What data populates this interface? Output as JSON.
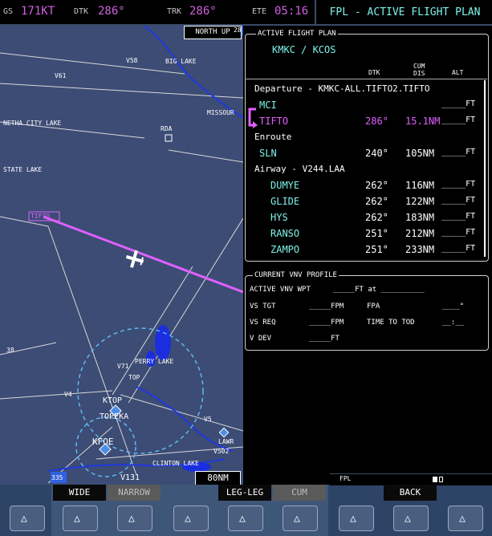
{
  "topbar": {
    "gs_label": "GS",
    "gs_value": "171KT",
    "dtk_label": "DTK",
    "dtk_value": "286°",
    "trk_label": "TRK",
    "trk_value": "286°",
    "ete_label": "ETE",
    "ete_value": "05:16",
    "fpl_title": "FPL - ACTIVE FLIGHT PLAN"
  },
  "map": {
    "north_up": "NORTH UP",
    "range": "80NM",
    "labels": [
      "V58",
      "BIG LAKE",
      "V61",
      "NETHA CITY LAKE",
      "RDA",
      "MISSOUR",
      "STATE LAKE",
      "TIFTO",
      "V4",
      "V71",
      "PERRY LAKE",
      "TOP",
      "KTOP",
      "TOPEKA",
      "KFOE",
      "V5",
      "V502",
      "LAWR",
      "CLINTON LAKE",
      "V131",
      "335",
      "28",
      "38"
    ]
  },
  "flight_plan": {
    "box_title": "ACTIVE FLIGHT PLAN",
    "route": "KMKC / KCOS",
    "headers": {
      "dtk": "DTK",
      "cum1": "CUM",
      "cum2": "DIS",
      "alt": "ALT"
    },
    "rows": [
      {
        "name": "Departure - KMKC-ALL.TIFTO2.TIFTO",
        "dtk": "",
        "dis": "",
        "alt": "",
        "type": "section"
      },
      {
        "name": "MCI",
        "dtk": "",
        "dis": "",
        "alt": "_____FT",
        "type": "wpt"
      },
      {
        "name": "TIFTO",
        "dtk": "286°",
        "dis": "15.1NM",
        "alt": "_____FT",
        "type": "active"
      },
      {
        "name": "Enroute",
        "dtk": "",
        "dis": "",
        "alt": "",
        "type": "section"
      },
      {
        "name": "SLN",
        "dtk": "240°",
        "dis": "105NM",
        "alt": "_____FT",
        "type": "wpt"
      },
      {
        "name": "Airway - V244.LAA",
        "dtk": "",
        "dis": "",
        "alt": "",
        "type": "section"
      },
      {
        "name": "DUMYE",
        "dtk": "262°",
        "dis": "116NM",
        "alt": "_____FT",
        "type": "wpt2"
      },
      {
        "name": "GLIDE",
        "dtk": "262°",
        "dis": "122NM",
        "alt": "_____FT",
        "type": "wpt2"
      },
      {
        "name": "HYS",
        "dtk": "262°",
        "dis": "183NM",
        "alt": "_____FT",
        "type": "wpt2"
      },
      {
        "name": "RANSO",
        "dtk": "251°",
        "dis": "212NM",
        "alt": "_____FT",
        "type": "wpt2"
      },
      {
        "name": "ZAMPO",
        "dtk": "251°",
        "dis": "233NM",
        "alt": "_____FT",
        "type": "wpt2"
      }
    ]
  },
  "vnv": {
    "box_title": "CURRENT VNV PROFILE",
    "active_label": "ACTIVE VNV WPT",
    "active_value": "_____FT  at  __________",
    "vstgt_label": "VS TGT",
    "vstgt_value": "_____FPM",
    "fpa_label": "FPA",
    "fpa_value": "____°",
    "vsreq_label": "VS REQ",
    "vsreq_value": "_____FPM",
    "tod_label": "TIME TO TOD",
    "tod_value": "__:__",
    "vdev_label": "V DEV",
    "vdev_value": "_____FT"
  },
  "softkeys": {
    "labels": [
      "",
      "WIDE",
      "NARROW",
      "",
      "LEG-LEG",
      "CUM",
      "",
      "BACK",
      ""
    ],
    "fpl_tag": "FPL"
  },
  "colors": {
    "magenta": "#e060ff",
    "cyan": "#7ef2ea",
    "map": "#3c4c74",
    "softkey": "#2e4466"
  }
}
